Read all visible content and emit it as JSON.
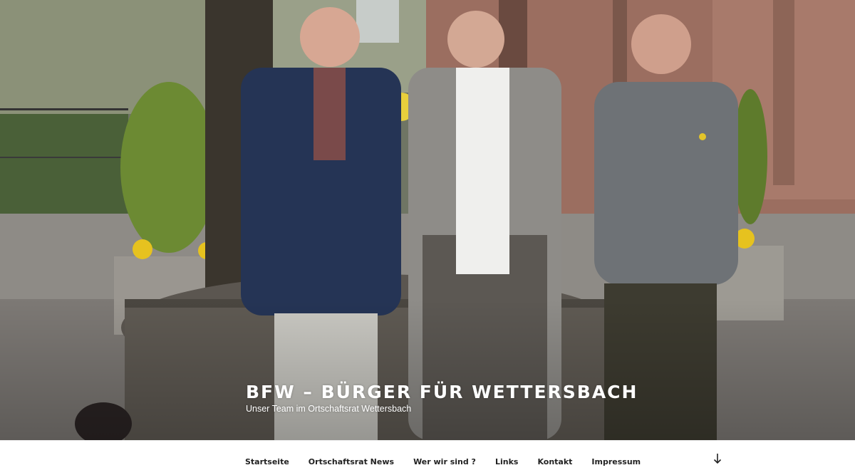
{
  "site": {
    "title": "BFW – BÜRGER FÜR WETTERSBACH",
    "description": "Unser Team im Ortschaftsrat Wettersbach"
  },
  "hero": {
    "image": "group-photo-three-people-village-well"
  },
  "nav": {
    "items": [
      {
        "label": "Startseite"
      },
      {
        "label": "Ortschaftsrat News"
      },
      {
        "label": "Wer wir sind ?"
      },
      {
        "label": "Links"
      },
      {
        "label": "Kontakt"
      },
      {
        "label": "Impressum"
      }
    ],
    "scroll_icon": "arrow-down-icon"
  }
}
